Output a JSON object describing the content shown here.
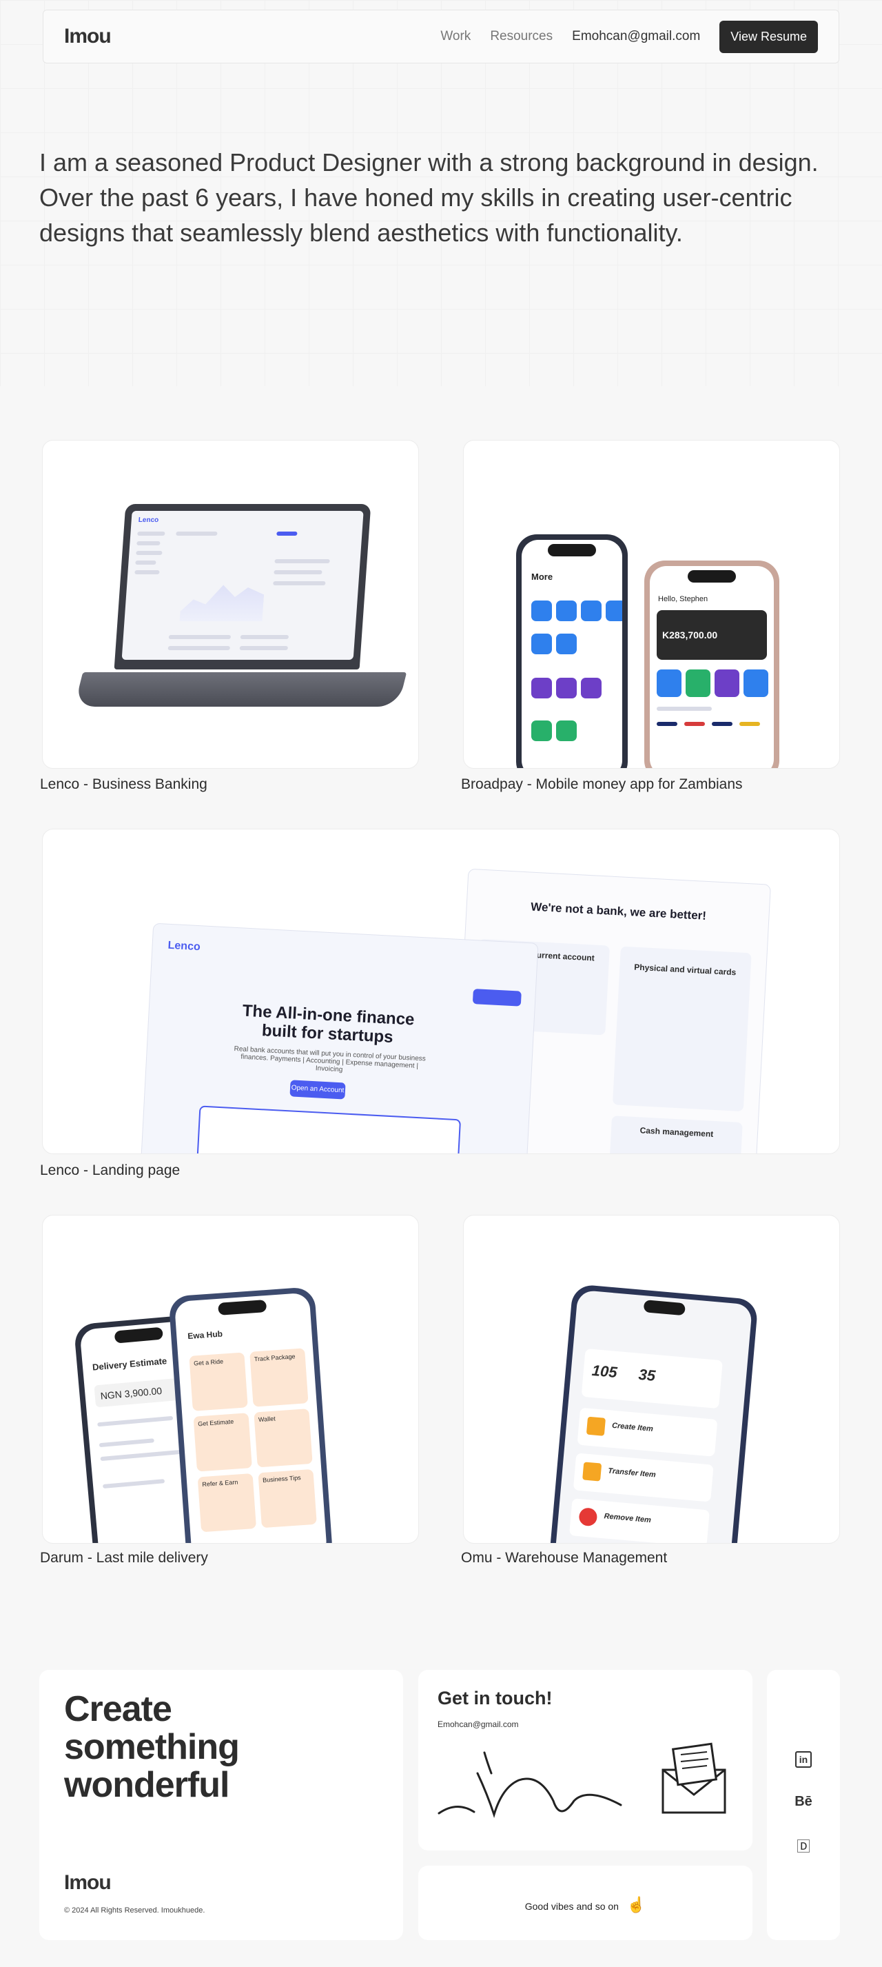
{
  "nav": {
    "logo": "Imou",
    "links": [
      "Work",
      "Resources"
    ],
    "email": "Emohcan@gmail.com",
    "resume_label": "View Resume"
  },
  "hero": {
    "intro": "I am a seasoned Product Designer with a strong background in design. Over the past 6 years, I have honed my skills in creating user-centric designs that seamlessly blend aesthetics with functionality."
  },
  "projects": [
    {
      "title": "Lenco - Business Banking"
    },
    {
      "title": "Broadpay - Mobile money app for Zambians"
    },
    {
      "title": "Lenco - Landing page"
    },
    {
      "title": "Darum - Last mile delivery"
    },
    {
      "title": "Omu - Warehouse Management"
    }
  ],
  "mock_text": {
    "lenco_brand": "Lenco",
    "broadpay_more": "More",
    "broadpay_hello": "Hello, Stephen",
    "broadpay_balance": "K283,700.00",
    "landing_headline": "The All-in-one finance built for startups",
    "landing_sub": "Real bank accounts that will put you in control of your business finances. Payments | Accounting | Expense management | Invoicing",
    "landing_cta": "Open an Account",
    "landing_side_title": "We're not a bank, we are better!",
    "landing_side_card1": "Business current account",
    "landing_side_card2": "Physical and virtual cards",
    "landing_side_card3": "Cash management",
    "darum_hub": "Ewa Hub",
    "darum_estimate": "Delivery Estimate",
    "darum_amount": "NGN 3,900.00",
    "darum_tiles": [
      "Get a Ride",
      "Track Package",
      "Get Estimate",
      "Wallet",
      "Refer & Earn",
      "Business Tips"
    ],
    "omu_n1": "105",
    "omu_n2": "35",
    "omu_items": [
      "Create Item",
      "Transfer Item",
      "Remove Item"
    ]
  },
  "footer": {
    "headline": "Create something wonderful",
    "logo": "Imou",
    "copyright": "© 2024 All Rights Reserved. Imoukhuede.",
    "contact_title": "Get in touch!",
    "contact_email": "Emohcan@gmail.com",
    "vibes": "Good vibes and so on",
    "socials": [
      "in",
      "Bē",
      "🄳"
    ]
  },
  "colors": {
    "accent_blue": "#4b5cf0",
    "dark_button": "#2a2a2a",
    "background": "#f7f7f7"
  }
}
